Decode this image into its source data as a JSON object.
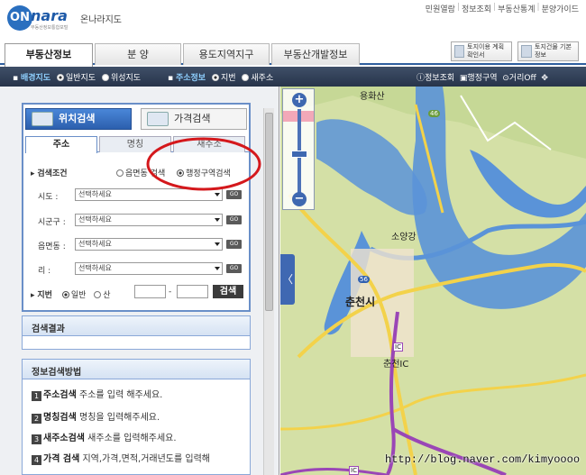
{
  "brand": {
    "logo_mark": "ON",
    "logo_text": "nara",
    "logo_sub": "부동산정보통합포털",
    "site_name": "온나라지도"
  },
  "top_links": [
    "민원열람",
    "정보조회",
    "부동산통계",
    "분양가이드"
  ],
  "main_tabs": [
    "부동산정보",
    "분 양",
    "용도지역지구",
    "부동산개발정보"
  ],
  "info_buttons": [
    {
      "label": "토지이용 계획확인서"
    },
    {
      "label": "토지건물 기본정보"
    }
  ],
  "layer_bar": {
    "bg_label": "배경지도",
    "bg_opt1": "일반지도",
    "bg_opt2": "위성지도",
    "addr_label": "주소정보",
    "addr_opt1": "지번",
    "addr_opt2": "새주소",
    "tool1": "정보조회",
    "tool2": "행정구역",
    "tool3": "거리Off"
  },
  "search": {
    "tab_location": "위치검색",
    "tab_price": "가격검색",
    "sub_tabs": [
      "주소",
      "명칭",
      "새주소"
    ],
    "condition_label": "검색조건",
    "cond_opt1": "읍면동 검색",
    "cond_opt2": "행정구역검색",
    "fields": [
      {
        "label": "시도 :",
        "placeholder": "선택하세요",
        "go": "GO"
      },
      {
        "label": "시군구 :",
        "placeholder": "선택하세요",
        "go": "GO"
      },
      {
        "label": "읍면동 :",
        "placeholder": "선택하세요",
        "go": "GO"
      },
      {
        "label": "리 :",
        "placeholder": "선택하세요",
        "go": "GO"
      }
    ],
    "jibun_label": "지번",
    "jibun_opt1": "일반",
    "jibun_opt2": "산",
    "dash": "-",
    "search_button": "검색"
  },
  "result": {
    "title": "검색결과"
  },
  "help": {
    "title": "정보검색방법",
    "items": [
      {
        "num": "1",
        "bold": "주소검색",
        "text": " 주소를 입력 해주세요."
      },
      {
        "num": "2",
        "bold": "명칭검색",
        "text": " 명칭을 입력해주세요."
      },
      {
        "num": "3",
        "bold": "새주소검색",
        "text": " 새주소를 입력해주세요."
      },
      {
        "num": "4",
        "bold": "가격 검색",
        "text": " 지역,가격,면적,거래년도를 입력해"
      }
    ]
  },
  "map": {
    "labels": {
      "hwasan": "용화산",
      "soyang": "소양강",
      "route46": "46",
      "route56": "56",
      "chuncheon": "춘천시",
      "ic_mark": "IC",
      "chuncheon_ic": "춘천IC",
      "ic_bottom": "IC"
    },
    "collapse": "〈"
  },
  "zoom": {
    "plus": "+",
    "minus": "−"
  },
  "watermark": "http://blog.naver.com/kimyoooo",
  "colors": {
    "accent": "#2f5f9e",
    "highlight_circle": "#d4181c",
    "water": "#4f8fd8",
    "land": "#d4e0a6"
  }
}
